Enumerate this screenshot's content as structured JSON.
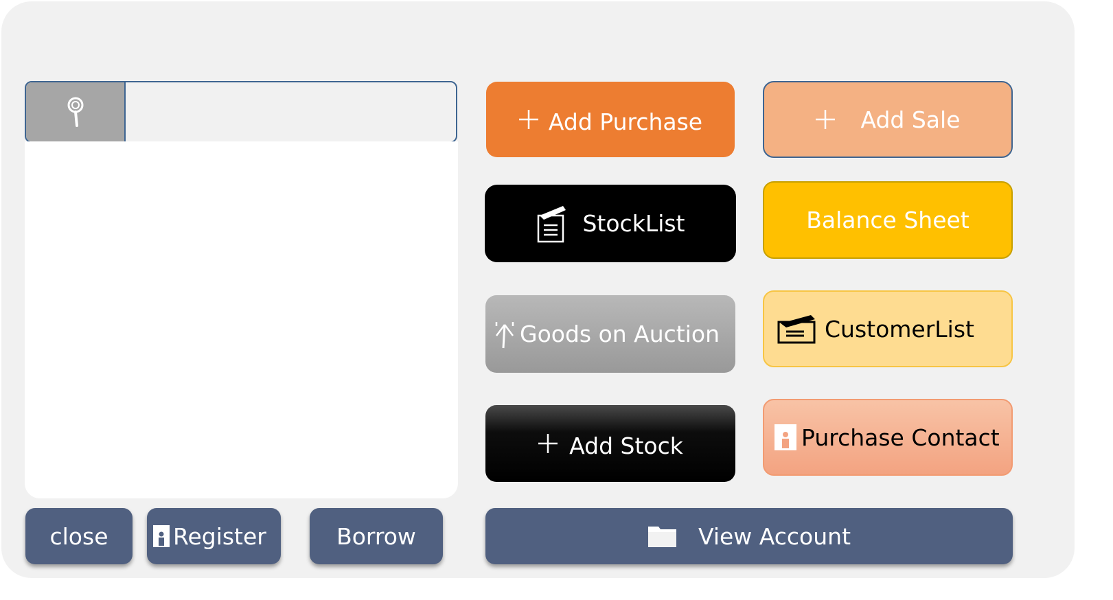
{
  "search": {
    "value": "",
    "placeholder": ""
  },
  "buttons": {
    "add_purchase": "Add Purchase",
    "add_sale": "Add Sale",
    "stocklist": "StockList",
    "balance_sheet": "Balance Sheet",
    "goods_on_auction": "Goods on Auction",
    "customer_list": "CustomerList",
    "add_stock": "Add Stock",
    "purchase_contact": "Purchase Contact"
  },
  "footer": {
    "close": "close",
    "register": "Register",
    "borrow": "Borrow",
    "view_account": "View Account"
  },
  "colors": {
    "window_bg": "#f1f1f1",
    "accent_blue": "#3e6591",
    "orange": "#ed7d31",
    "light_orange": "#f4b183",
    "gold": "#ffc000",
    "pale_gold": "#fedc91",
    "salmon": "#f3a381",
    "slate": "#506080"
  },
  "icons": {
    "search": "magnifier-icon",
    "add": "plus-icon",
    "stocklist": "document-pen-icon",
    "auction": "antenna-icon",
    "customer": "clipboard-pen-icon",
    "contact": "contact-card-icon",
    "register": "contact-card-icon",
    "view_account": "folder-icon"
  }
}
